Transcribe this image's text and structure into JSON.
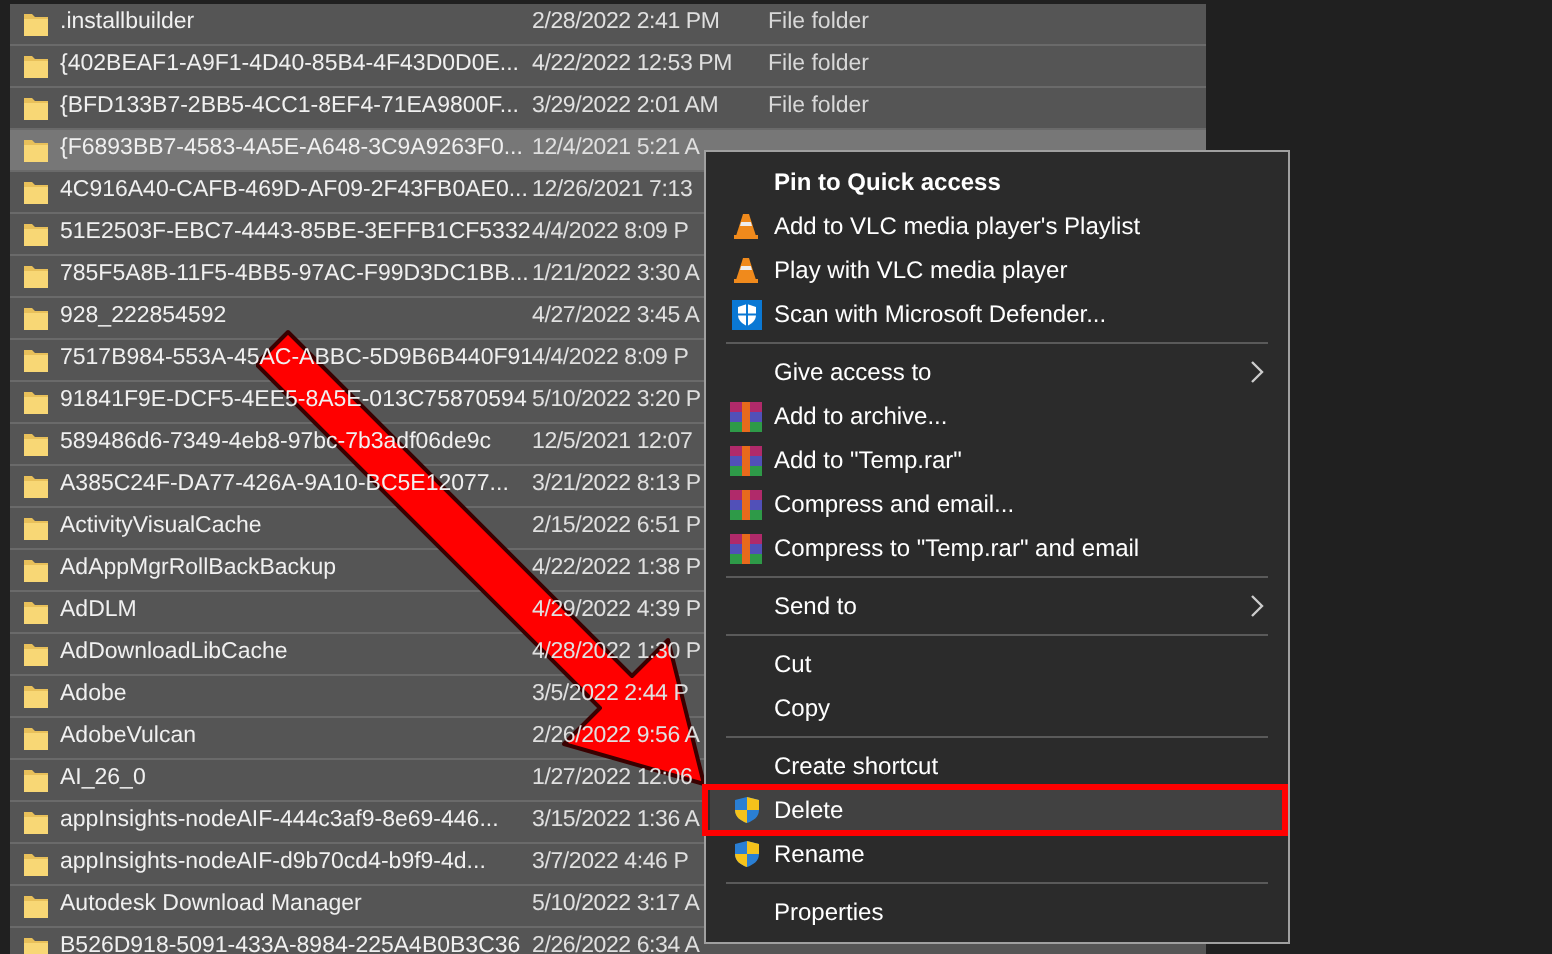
{
  "files": [
    {
      "name": ".installbuilder",
      "date": "2/28/2022 2:41 PM",
      "type": "File folder",
      "selected": true,
      "focused": false
    },
    {
      "name": "{402BEAF1-A9F1-4D40-85B4-4F43D0D0E...",
      "date": "4/22/2022 12:53 PM",
      "type": "File folder",
      "selected": true,
      "focused": false
    },
    {
      "name": "{BFD133B7-2BB5-4CC1-8EF4-71EA9800F...",
      "date": "3/29/2022 2:01 AM",
      "type": "File folder",
      "selected": true,
      "focused": false
    },
    {
      "name": "{F6893BB7-4583-4A5E-A648-3C9A9263F0...",
      "date": "12/4/2021 5:21 A",
      "selected": true,
      "focused": true
    },
    {
      "name": "4C916A40-CAFB-469D-AF09-2F43FB0AE0...",
      "date": "12/26/2021 7:13",
      "selected": true,
      "focused": false
    },
    {
      "name": "51E2503F-EBC7-4443-85BE-3EFFB1CF5332",
      "date": "4/4/2022 8:09 P",
      "selected": true,
      "focused": false
    },
    {
      "name": "785F5A8B-11F5-4BB5-97AC-F99D3DC1BB...",
      "date": "1/21/2022 3:30 A",
      "selected": true,
      "focused": false
    },
    {
      "name": "928_222854592",
      "date": "4/27/2022 3:45 A",
      "selected": true,
      "focused": false
    },
    {
      "name": "7517B984-553A-45AC-ABBC-5D9B6B440F91",
      "date": "4/4/2022 8:09 P",
      "selected": true,
      "focused": false
    },
    {
      "name": "91841F9E-DCF5-4EE5-8A5E-013C75870594",
      "date": "5/10/2022 3:20 P",
      "selected": true,
      "focused": false
    },
    {
      "name": "589486d6-7349-4eb8-97bc-7b3adf06de9c",
      "date": "12/5/2021 12:07",
      "selected": true,
      "focused": false
    },
    {
      "name": "A385C24F-DA77-426A-9A10-BC5E12077...",
      "date": "3/21/2022 8:13 P",
      "selected": true,
      "focused": false
    },
    {
      "name": "ActivityVisualCache",
      "date": "2/15/2022 6:51 P",
      "selected": true,
      "focused": false
    },
    {
      "name": "AdAppMgrRollBackBackup",
      "date": "4/22/2022 1:38 P",
      "selected": true,
      "focused": false
    },
    {
      "name": "AdDLM",
      "date": "4/29/2022 4:39 P",
      "selected": true,
      "focused": false
    },
    {
      "name": "AdDownloadLibCache",
      "date": "4/28/2022 1:30 P",
      "selected": true,
      "focused": false
    },
    {
      "name": "Adobe",
      "date": "3/5/2022 2:44 P",
      "selected": true,
      "focused": false
    },
    {
      "name": "AdobeVulcan",
      "date": "2/26/2022 9:56 A",
      "selected": true,
      "focused": false
    },
    {
      "name": "AI_26_0",
      "date": "1/27/2022 12:06",
      "selected": true,
      "focused": false
    },
    {
      "name": "appInsights-nodeAIF-444c3af9-8e69-446...",
      "date": "3/15/2022 1:36 A",
      "selected": true,
      "focused": false
    },
    {
      "name": "appInsights-nodeAIF-d9b70cd4-b9f9-4d...",
      "date": "3/7/2022 4:46 P",
      "selected": true,
      "focused": false
    },
    {
      "name": "Autodesk Download Manager",
      "date": "5/10/2022 3:17 A",
      "selected": true,
      "focused": false
    },
    {
      "name": "B526D918-5091-433A-8984-225A4B0B3C36",
      "date": "2/26/2022 6:34 A",
      "selected": true,
      "focused": false
    }
  ],
  "context_menu": [
    {
      "kind": "bold",
      "label": "Pin to Quick access",
      "selected": false
    },
    {
      "kind": "vlc",
      "label": "Add to VLC media player's Playlist",
      "selected": false
    },
    {
      "kind": "vlc",
      "label": "Play with VLC media player",
      "selected": false
    },
    {
      "kind": "defender",
      "label": "Scan with Microsoft Defender...",
      "selected": false
    },
    {
      "kind": "separator"
    },
    {
      "kind": "submenu",
      "label": "Give access to",
      "selected": false
    },
    {
      "kind": "archive",
      "label": "Add to archive...",
      "selected": false
    },
    {
      "kind": "archive",
      "label": "Add to \"Temp.rar\"",
      "selected": false
    },
    {
      "kind": "archive",
      "label": "Compress and email...",
      "selected": false
    },
    {
      "kind": "archive",
      "label": "Compress to \"Temp.rar\" and email",
      "selected": false
    },
    {
      "kind": "separator"
    },
    {
      "kind": "submenu",
      "label": "Send to",
      "selected": false
    },
    {
      "kind": "separator"
    },
    {
      "kind": "plain",
      "label": "Cut",
      "selected": false
    },
    {
      "kind": "plain",
      "label": "Copy",
      "selected": false
    },
    {
      "kind": "separator"
    },
    {
      "kind": "plain",
      "label": "Create shortcut",
      "selected": false
    },
    {
      "kind": "shield",
      "label": "Delete",
      "selected": true
    },
    {
      "kind": "shield",
      "label": "Rename",
      "selected": false
    },
    {
      "kind": "separator"
    },
    {
      "kind": "plain",
      "label": "Properties",
      "selected": false
    }
  ]
}
